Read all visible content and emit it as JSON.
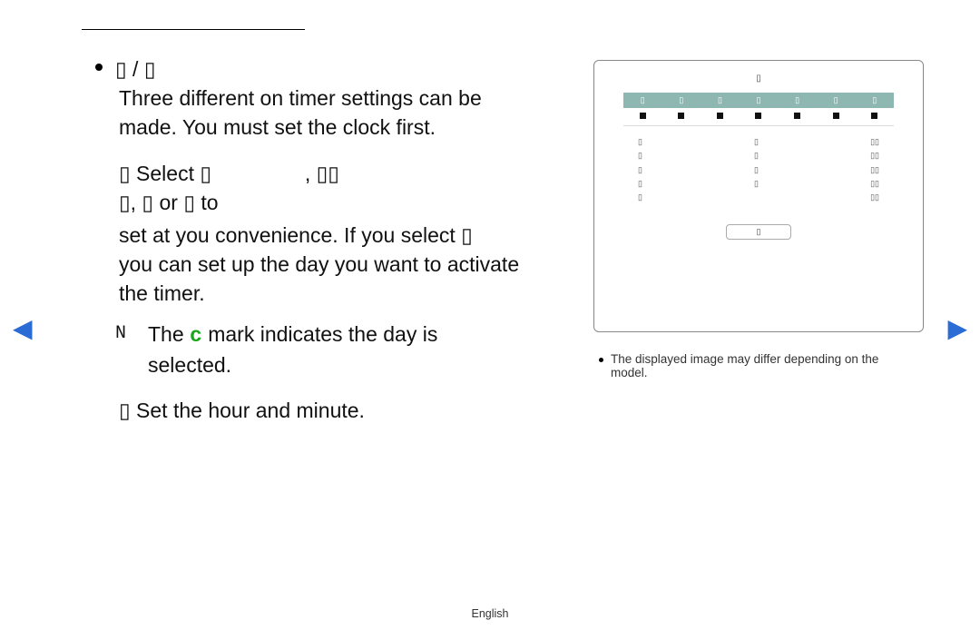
{
  "section_heading_glyph": "▯",
  "bullet": {
    "title_glyphs": "▯ / ▯",
    "line1": "Three different on timer settings can be",
    "line2": "made. You must set the clock first.",
    "select_prefix": "▯ Select ▯",
    "select_mid": ", ▯▯",
    "select_line2": "▯, ▯ or ▯ to",
    "conv_line1": "set at you convenience. If you select ▯",
    "conv_line2": "you can set up the day you want to activate",
    "conv_line3": "the timer.",
    "note_marker": "N",
    "note_text_pre": "The ",
    "note_mark": "c",
    "note_text_post": " mark indicates the day is",
    "note_text_line2": "selected.",
    "time_label": "▯ Set the hour and minute."
  },
  "osd": {
    "title": "▯",
    "days": [
      "▯",
      "▯",
      "▯",
      "▯",
      "▯",
      "▯",
      "▯"
    ],
    "rows": [
      {
        "left": "▯",
        "mid": "▯",
        "right": "▯▯"
      },
      {
        "left": "▯",
        "mid": "▯",
        "right": "▯▯"
      },
      {
        "left": "▯",
        "mid": "▯",
        "right": "▯▯"
      },
      {
        "left": "▯",
        "mid": "▯",
        "right": "▯▯"
      },
      {
        "left": "▯",
        "mid": "",
        "right": "▯▯"
      }
    ],
    "close": "▯"
  },
  "osd_note": "The displayed image may differ depending on the model.",
  "footer": {
    "language": "English"
  }
}
